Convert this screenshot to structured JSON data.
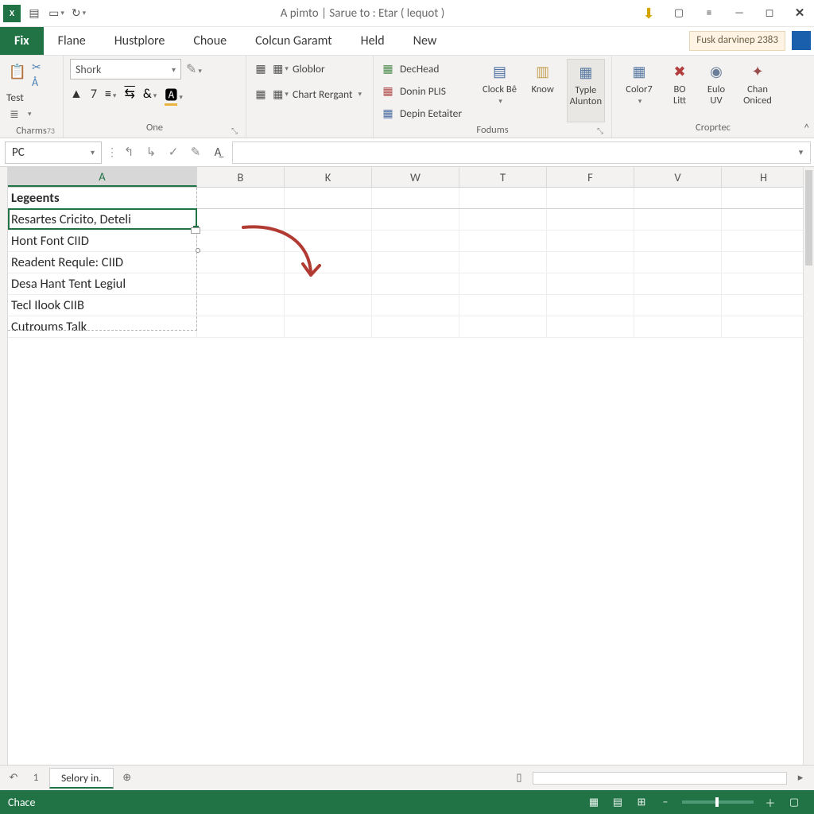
{
  "titlebar": {
    "title": "A pimto | Sarue to : Etar ( lequot )",
    "qat": [
      "excel",
      "doc",
      "page",
      "arrow",
      "refresh",
      "drop"
    ]
  },
  "topbadge": {
    "text": "Fusk darvinep 2383"
  },
  "menu": {
    "tabs": [
      "Fix",
      "Flane",
      "Hustplore",
      "Choue",
      "Colcun Garamt",
      "Held",
      "New"
    ],
    "activeIndex": 0
  },
  "ribbon": {
    "group1_label": "Charms",
    "test_label": "Test",
    "font_name": "Shork",
    "one_label": "One",
    "globlor": "Globlor",
    "chartreg": "Chart Rergant",
    "fontnum": "7",
    "groupF_label": "Fodums",
    "declhead": "DecHead",
    "doninplus": "Donin PLIS",
    "depinetatter": "Depin Eetaiter",
    "clockbe": "Clock Bê",
    "know": "Know",
    "typle": "Typle\nAlunton",
    "groupC_label": "Croprtec",
    "color7": "Color7",
    "bolist": "BO\nLitt",
    "eulouv": "Eulo\nUV",
    "chanoniced": "Chan\nOniced",
    "group1_num": "73"
  },
  "formula": {
    "namebox": "PC"
  },
  "columns": [
    "A",
    "B",
    "K",
    "W",
    "T",
    "F",
    "V",
    "H"
  ],
  "cellsA": [
    "Legeents",
    "Resartes Cricito, Deteli",
    "Hont Font CIID",
    "Readent Requle: CIID",
    "Desa Hant Tent Legiul",
    "Tecl Ilook CIIB",
    "Cutroums Talk"
  ],
  "sheet": {
    "nav_num": "1",
    "active_tab": "Selory in."
  },
  "status": {
    "label": "Chace"
  }
}
